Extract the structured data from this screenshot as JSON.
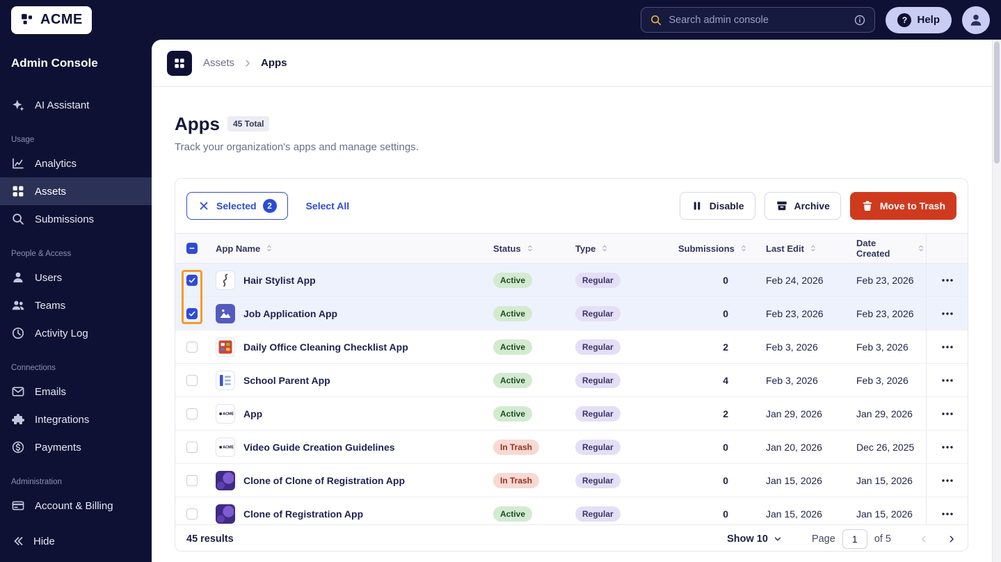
{
  "brand": {
    "name": "ACME"
  },
  "colors": {
    "accent_blue": "#2e4bd8",
    "danger_red": "#cf3a1f",
    "annotation_orange": "#f59b2d",
    "status_active_bg": "#d3ead0",
    "status_trash_bg": "#f8d9d3",
    "type_regular_bg": "#e4dff6",
    "navy": "#0e1133"
  },
  "topbar": {
    "search_placeholder": "Search admin console",
    "help_label": "Help"
  },
  "sidebar": {
    "title": "Admin Console",
    "assistant": {
      "label": "AI Assistant",
      "icon": "sparkle"
    },
    "sections": [
      {
        "label": "Usage",
        "items": [
          {
            "label": "Analytics",
            "icon": "analytics",
            "active": false
          },
          {
            "label": "Assets",
            "icon": "grid-apps",
            "active": true
          },
          {
            "label": "Submissions",
            "icon": "search",
            "active": false
          }
        ]
      },
      {
        "label": "People & Access",
        "items": [
          {
            "label": "Users",
            "icon": "user",
            "active": false
          },
          {
            "label": "Teams",
            "icon": "users",
            "active": false
          },
          {
            "label": "Activity Log",
            "icon": "clock",
            "active": false
          }
        ]
      },
      {
        "label": "Connections",
        "items": [
          {
            "label": "Emails",
            "icon": "mail",
            "active": false
          },
          {
            "label": "Integrations",
            "icon": "puzzle",
            "active": false
          },
          {
            "label": "Payments",
            "icon": "dollar",
            "active": false
          }
        ]
      },
      {
        "label": "Administration",
        "items": [
          {
            "label": "Account & Billing",
            "icon": "card",
            "active": false
          }
        ]
      }
    ],
    "hide_label": "Hide"
  },
  "breadcrumb": {
    "section": "Assets",
    "page": "Apps"
  },
  "page": {
    "title": "Apps",
    "total_badge": "45 Total",
    "subtitle": "Track your organization's apps and manage settings."
  },
  "toolbar": {
    "selected_label": "Selected",
    "selected_count": "2",
    "select_all_label": "Select All",
    "disable_label": "Disable",
    "archive_label": "Archive",
    "trash_label": "Move to Trash"
  },
  "table": {
    "columns": [
      {
        "label": "App Name"
      },
      {
        "label": "Status"
      },
      {
        "label": "Type"
      },
      {
        "label": "Submissions"
      },
      {
        "label": "Last Edit"
      },
      {
        "label": "Date Created"
      }
    ],
    "rows": [
      {
        "name": "Hair Stylist App",
        "icon": "hair",
        "status": "Active",
        "type": "Regular",
        "submissions": "0",
        "last_edit": "Feb 24, 2026",
        "date_created": "Feb 23, 2026",
        "selected": true
      },
      {
        "name": "Job Application App",
        "icon": "image",
        "status": "Active",
        "type": "Regular",
        "submissions": "0",
        "last_edit": "Feb 23, 2026",
        "date_created": "Feb 23, 2026",
        "selected": true
      },
      {
        "name": "Daily Office Cleaning Checklist App",
        "icon": "checklist",
        "status": "Active",
        "type": "Regular",
        "submissions": "2",
        "last_edit": "Feb 3, 2026",
        "date_created": "Feb 3, 2026",
        "selected": false
      },
      {
        "name": "School Parent App",
        "icon": "school",
        "status": "Active",
        "type": "Regular",
        "submissions": "4",
        "last_edit": "Feb 3, 2026",
        "date_created": "Feb 3, 2026",
        "selected": false
      },
      {
        "name": "App",
        "icon": "acme",
        "status": "Active",
        "type": "Regular",
        "submissions": "2",
        "last_edit": "Jan 29, 2026",
        "date_created": "Jan 29, 2026",
        "selected": false
      },
      {
        "name": "Video Guide Creation Guidelines",
        "icon": "acme",
        "status": "In Trash",
        "type": "Regular",
        "submissions": "0",
        "last_edit": "Jan 20, 2026",
        "date_created": "Dec 26, 2025",
        "selected": false
      },
      {
        "name": "Clone of Clone of Registration App",
        "icon": "purple",
        "status": "In Trash",
        "type": "Regular",
        "submissions": "0",
        "last_edit": "Jan 15, 2026",
        "date_created": "Jan 15, 2026",
        "selected": false
      },
      {
        "name": "Clone of Registration App",
        "icon": "purple",
        "status": "Active",
        "type": "Regular",
        "submissions": "0",
        "last_edit": "Jan 15, 2026",
        "date_created": "Jan 15, 2026",
        "selected": false
      }
    ]
  },
  "footer": {
    "results": "45 results",
    "show_label": "Show 10",
    "page_label": "Page",
    "page_value": "1",
    "of_label": "of 5"
  }
}
